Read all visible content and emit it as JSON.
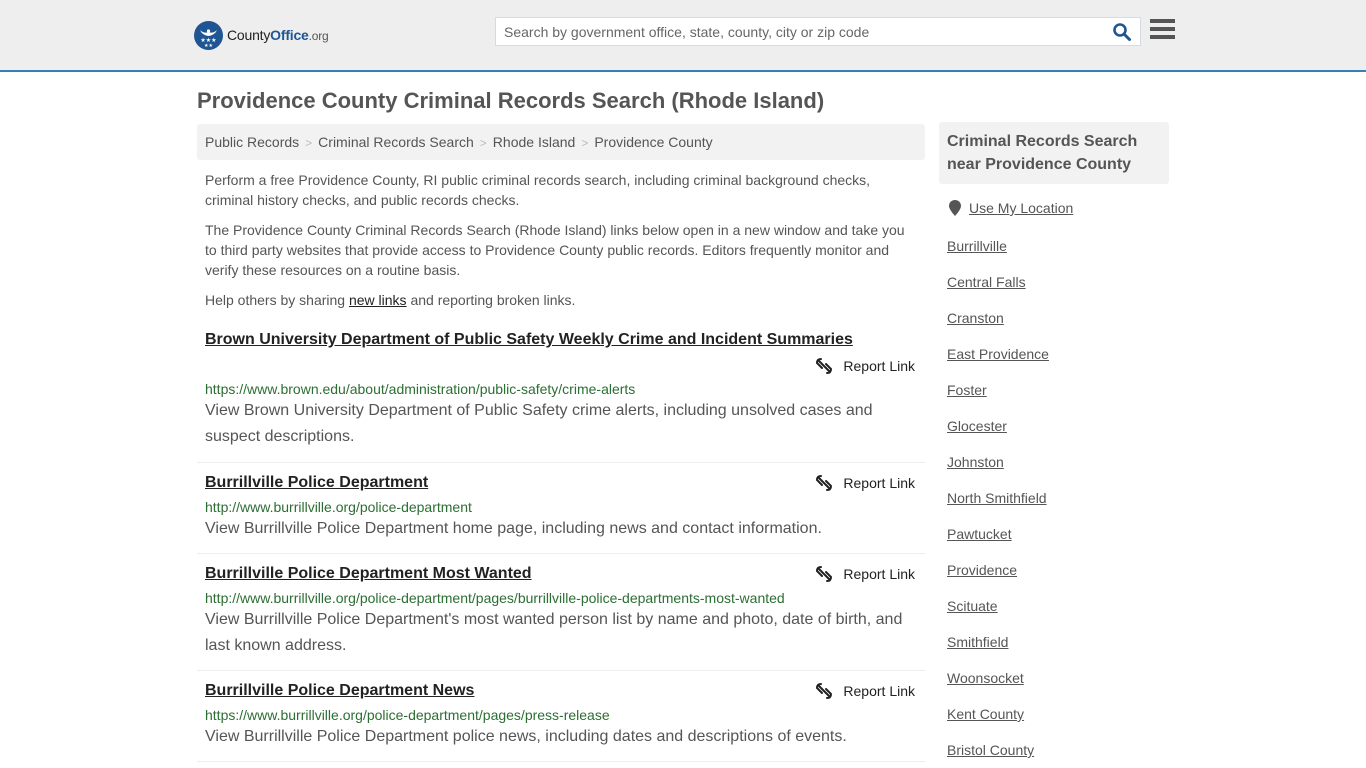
{
  "header": {
    "logo": {
      "name": "County",
      "highlight": "Office",
      "tld": ".org"
    },
    "search": {
      "placeholder": "Search by government office, state, county, city or zip code",
      "value": ""
    }
  },
  "page": {
    "title": "Providence County Criminal Records Search (Rhode Island)",
    "breadcrumb": [
      "Public Records",
      "Criminal Records Search",
      "Rhode Island",
      "Providence County"
    ],
    "intro": [
      "Perform a free Providence County, RI public criminal records search, including criminal background checks, criminal history checks, and public records checks.",
      "The Providence County Criminal Records Search (Rhode Island) links below open in a new window and take you to third party websites that provide access to Providence County public records. Editors frequently monitor and verify these resources on a routine basis."
    ],
    "share": {
      "prefix": "Help others by sharing ",
      "link": "new links",
      "suffix": " and reporting broken links."
    },
    "report_label": "Report Link",
    "entries": [
      {
        "title": "Brown University Department of Public Safety Weekly Crime and Incident Summaries",
        "url": "https://www.brown.edu/about/administration/public-safety/crime-alerts",
        "description": "View Brown University Department of Public Safety crime alerts, including unsolved cases and suspect descriptions."
      },
      {
        "title": "Burrillville Police Department",
        "url": "http://www.burrillville.org/police-department",
        "description": "View Burrillville Police Department home page, including news and contact information."
      },
      {
        "title": "Burrillville Police Department Most Wanted",
        "url": "http://www.burrillville.org/police-department/pages/burrillville-police-departments-most-wanted",
        "description": "View Burrillville Police Department's most wanted person list by name and photo, date of birth, and last known address."
      },
      {
        "title": "Burrillville Police Department News",
        "url": "https://www.burrillville.org/police-department/pages/press-release",
        "description": "View Burrillville Police Department police news, including dates and descriptions of events."
      }
    ]
  },
  "sidebar": {
    "heading": "Criminal Records Search near Providence County",
    "use_location": "Use My Location",
    "links": [
      "Burrillville",
      "Central Falls",
      "Cranston",
      "East Providence",
      "Foster",
      "Glocester",
      "Johnston",
      "North Smithfield",
      "Pawtucket",
      "Providence",
      "Scituate",
      "Smithfield",
      "Woonsocket",
      "Kent County",
      "Bristol County"
    ]
  },
  "colors": {
    "brand": "#1f5593",
    "header_border": "#3a7fb3",
    "url_green": "#2c6e33"
  }
}
